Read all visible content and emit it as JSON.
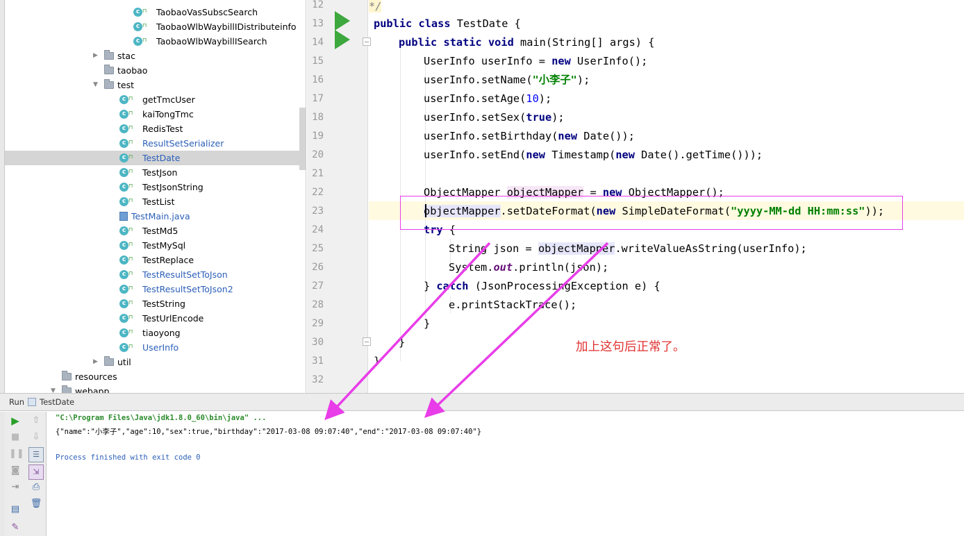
{
  "tree": {
    "items": [
      {
        "type": "class",
        "label": "TaobaoVasSubscSearch",
        "blue": false
      },
      {
        "type": "class",
        "label": "TaobaoWlbWaybillIDistributeinfo",
        "blue": false
      },
      {
        "type": "class",
        "label": "TaobaoWlbWaybillISearch",
        "blue": false
      },
      {
        "type": "folder",
        "label": "stac",
        "collapsed": true
      },
      {
        "type": "folder",
        "label": "taobao"
      },
      {
        "type": "folder",
        "label": "test",
        "expanded": true
      },
      {
        "type": "runclass",
        "label": "getTmcUser",
        "blue": false
      },
      {
        "type": "runclass",
        "label": "kaiTongTmc",
        "blue": false
      },
      {
        "type": "runclass",
        "label": "RedisTest",
        "blue": false
      },
      {
        "type": "class",
        "label": "ResultSetSerializer",
        "blue": true
      },
      {
        "type": "runclass",
        "label": "TestDate",
        "blue": true,
        "selected": true
      },
      {
        "type": "runclass",
        "label": "TestJson",
        "blue": false
      },
      {
        "type": "runclass",
        "label": "TestJsonString",
        "blue": false
      },
      {
        "type": "runclass",
        "label": "TestList",
        "blue": false
      },
      {
        "type": "java",
        "label": "TestMain.java",
        "blue": true
      },
      {
        "type": "runclass",
        "label": "TestMd5",
        "blue": false
      },
      {
        "type": "runclass",
        "label": "TestMySql",
        "blue": false
      },
      {
        "type": "runclass",
        "label": "TestReplace",
        "blue": false
      },
      {
        "type": "runclass",
        "label": "TestResultSetToJson",
        "blue": true
      },
      {
        "type": "runclass",
        "label": "TestResultSetToJson2",
        "blue": true
      },
      {
        "type": "runclass",
        "label": "TestString",
        "blue": false
      },
      {
        "type": "runclass",
        "label": "TestUrlEncode",
        "blue": false
      },
      {
        "type": "runclass",
        "label": "tiaoyong",
        "blue": false
      },
      {
        "type": "class",
        "label": "UserInfo",
        "blue": true
      },
      {
        "type": "folder",
        "label": "util",
        "collapsed": true
      },
      {
        "type": "folder",
        "label": "resources",
        "level": 1
      },
      {
        "type": "folder",
        "label": "webapp",
        "level": 1,
        "expanded": true
      }
    ]
  },
  "editor": {
    "line_numbers": [
      "12",
      "13",
      "14",
      "15",
      "16",
      "17",
      "18",
      "19",
      "20",
      "21",
      "22",
      "23",
      "24",
      "25",
      "26",
      "27",
      "28",
      "29",
      "30",
      "31",
      "32"
    ],
    "lines": {
      "l12": "*/",
      "l13": {
        "kw1": "public",
        "kw2": "class",
        "rest": " TestDate {"
      },
      "l14": {
        "kw1": "public",
        "kw2": "static",
        "kw3": "void",
        "rest": " main(String[] args) {"
      },
      "l15": {
        "a": "UserInfo userInfo = ",
        "kw": "new",
        "b": " UserInfo();"
      },
      "l16": {
        "a": "userInfo.setName(",
        "str": "\"小李子\"",
        "b": ");"
      },
      "l17": {
        "a": "userInfo.setAge(",
        "num": "10",
        "b": ");"
      },
      "l18": {
        "a": "userInfo.setSex(",
        "kw": "true",
        "b": ");"
      },
      "l19": {
        "a": "userInfo.setBirthday(",
        "kw": "new",
        "b": " Date());"
      },
      "l20": {
        "a": "userInfo.setEnd(",
        "kw1": "new",
        "b": " Timestamp(",
        "kw2": "new",
        "c": " Date().getTime()));"
      },
      "l22": {
        "a": "ObjectMapper ",
        "hl": "objectMapper",
        "b": " = ",
        "kw": "new",
        "c": " ObjectMapper();"
      },
      "l23": {
        "hl": "objectMapper",
        "a": ".setDateFormat(",
        "kw": "new",
        "b": " SimpleDateFormat(",
        "str": "\"yyyy-MM-dd HH:mm:ss\"",
        "c": "));"
      },
      "l24": {
        "kw": "try",
        "a": " {"
      },
      "l25": {
        "a": "String json = ",
        "hl": "objectMapper",
        "b": ".writeValueAsString(userInfo);"
      },
      "l26": {
        "a": "System.",
        "fld": "out",
        "b": ".println(json);"
      },
      "l27": {
        "a": "} ",
        "kw": "catch",
        "b": " (JsonProcessingException e) {"
      },
      "l28": "e.printStackTrace();",
      "l29": "}",
      "l30": "}",
      "l31": "}"
    },
    "annotation": "加上这句后正常了。",
    "colors": {
      "keyword": "#000080",
      "string": "#008000",
      "annotation_box": "#e83de8",
      "annotation_text": "#e03030"
    }
  },
  "run": {
    "label": "Run",
    "tab": "TestDate",
    "console": {
      "cmd": "\"C:\\Program Files\\Java\\jdk1.8.0_60\\bin\\java\" ...",
      "output": "{\"name\":\"小李子\",\"age\":10,\"sex\":true,\"birthday\":\"2017-03-08 09:07:40\",\"end\":\"2017-03-08 09:07:40\"}",
      "exit": "Process finished with exit code 0"
    }
  }
}
